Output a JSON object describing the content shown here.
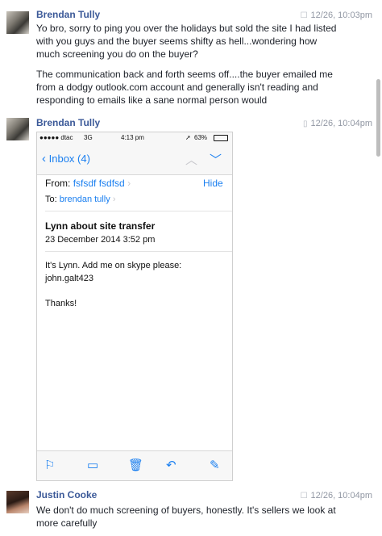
{
  "messages": [
    {
      "sender": "Brendan Tully",
      "timestamp": "12/26, 10:03pm",
      "paragraphs": [
        "Yo bro, sorry to ping you over the holidays but sold the site I had listed with you guys and the buyer seems shifty as hell...wondering how much screening you do on the buyer?",
        "The communication back and forth seems off....the buyer emailed me from a dodgy outlook.com account and generally isn't reading and responding to emails like a sane normal person would"
      ]
    },
    {
      "sender": "Brendan Tully",
      "timestamp": "12/26, 10:04pm"
    },
    {
      "sender": "Justin Cooke",
      "timestamp": "12/26, 10:04pm",
      "paragraphs": [
        "We don't do much screening of buyers, honestly. It's sellers we look at more carefully"
      ]
    }
  ],
  "screenshot": {
    "status": {
      "carrier": "●●●●● dtac",
      "network": "3G",
      "time": "4:13 pm",
      "battery": "63%"
    },
    "nav": {
      "back_label": "Inbox (4)"
    },
    "email": {
      "from_label": "From:",
      "from_value": "fsfsdf fsdfsd",
      "hide_label": "Hide",
      "to_label": "To:",
      "to_value": "brendan tully",
      "subject": "Lynn about site transfer",
      "date": "23 December 2014 3:52 pm",
      "body_line1": "It's Lynn. Add me on skype please:",
      "body_line2": "john.galt423",
      "body_line3": "Thanks!"
    },
    "toolbar_icons": [
      "flag-icon",
      "folder-icon",
      "trash-icon",
      "reply-icon",
      "compose-icon"
    ]
  }
}
